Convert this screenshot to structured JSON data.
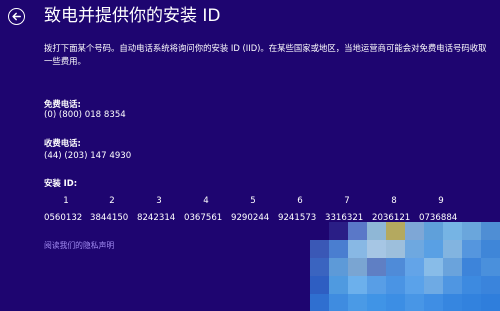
{
  "header": {
    "title": "致电并提供你的安装 ID"
  },
  "description": "拨打下面某个号码。自动电话系统将询问你的安装 ID (IID)。在某些国家或地区，当地运营商可能会对免费电话号码收取一些费用。",
  "toll_free": {
    "label": "免费电话:",
    "number": "(0) (800) 018 8354"
  },
  "toll": {
    "label": "收费电话:",
    "number": "(44) (203) 147 4930"
  },
  "install_id": {
    "label": "安装 ID:",
    "groups": [
      {
        "index": "1",
        "code": "0560132"
      },
      {
        "index": "2",
        "code": "3844150"
      },
      {
        "index": "3",
        "code": "8242314"
      },
      {
        "index": "4",
        "code": "0367561"
      },
      {
        "index": "5",
        "code": "9290244"
      },
      {
        "index": "6",
        "code": "9241573"
      },
      {
        "index": "7",
        "code": "3316321"
      },
      {
        "index": "8",
        "code": "2036121"
      },
      {
        "index": "9",
        "code": "0736884"
      }
    ]
  },
  "privacy_link": "阅读我们的隐私声明",
  "colors": {
    "background": "#1e0570",
    "text": "#ffffff",
    "link": "#a18bf2"
  },
  "icons": {
    "back": "back-arrow-circle-icon"
  }
}
